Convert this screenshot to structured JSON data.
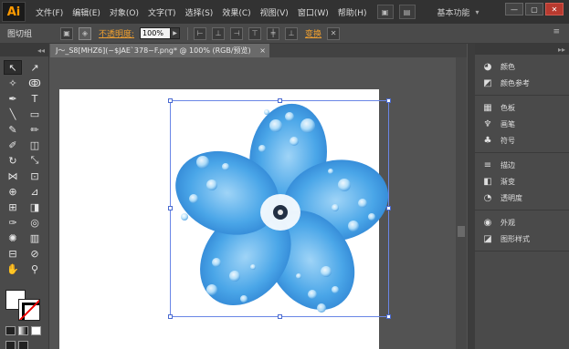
{
  "app": {
    "logo": "Ai"
  },
  "menu": [
    "文件(F)",
    "编辑(E)",
    "对象(O)",
    "文字(T)",
    "选择(S)",
    "效果(C)",
    "视图(V)",
    "窗口(W)",
    "帮助(H)"
  ],
  "menubar": {
    "workspace": "基本功能",
    "workspace_caret": "▾",
    "window_buttons": {
      "minimize": "—",
      "maximize": "▢",
      "close": "✕"
    }
  },
  "control": {
    "selection_label": "图切组",
    "opacity_label": "不透明度:",
    "opacity_value": "100%",
    "transform_label": "变换"
  },
  "document": {
    "tab_title": "J～_S8[MHZ6](~$JAE`378~F.png* @ 100% (RGB/预览)",
    "close": "×"
  },
  "panels": {
    "group1": [
      {
        "icon": "palette-icon",
        "glyph": "◕",
        "label": "颜色"
      },
      {
        "icon": "color-guide-icon",
        "glyph": "◩",
        "label": "颜色参考"
      }
    ],
    "group2": [
      {
        "icon": "swatches-icon",
        "glyph": "▦",
        "label": "色板"
      },
      {
        "icon": "brushes-icon",
        "glyph": "♆",
        "label": "画笔"
      },
      {
        "icon": "symbols-icon",
        "glyph": "♣",
        "label": "符号"
      }
    ],
    "group3": [
      {
        "icon": "stroke-icon",
        "glyph": "≡",
        "label": "描边"
      },
      {
        "icon": "gradient-icon",
        "glyph": "◧",
        "label": "渐变"
      },
      {
        "icon": "transparency-icon",
        "glyph": "◔",
        "label": "透明度"
      }
    ],
    "group4": [
      {
        "icon": "appearance-icon",
        "glyph": "◉",
        "label": "外观"
      },
      {
        "icon": "graphic-styles-icon",
        "glyph": "◪",
        "label": "图形样式"
      }
    ]
  },
  "tools": [
    {
      "name": "selection-tool-icon",
      "glyph": "↖"
    },
    {
      "name": "direct-selection-tool-icon",
      "glyph": "↗"
    },
    {
      "name": "magic-wand-tool-icon",
      "glyph": "✧"
    },
    {
      "name": "lasso-tool-icon",
      "glyph": "ↂ"
    },
    {
      "name": "pen-tool-icon",
      "glyph": "✒"
    },
    {
      "name": "type-tool-icon",
      "glyph": "T"
    },
    {
      "name": "line-tool-icon",
      "glyph": "╲"
    },
    {
      "name": "rectangle-tool-icon",
      "glyph": "▭"
    },
    {
      "name": "paintbrush-tool-icon",
      "glyph": "✎"
    },
    {
      "name": "pencil-tool-icon",
      "glyph": "✏"
    },
    {
      "name": "blob-brush-tool-icon",
      "glyph": "✐"
    },
    {
      "name": "eraser-tool-icon",
      "glyph": "◫"
    },
    {
      "name": "rotate-tool-icon",
      "glyph": "↻"
    },
    {
      "name": "scale-tool-icon",
      "glyph": "⤡"
    },
    {
      "name": "width-tool-icon",
      "glyph": "⋈"
    },
    {
      "name": "free-transform-tool-icon",
      "glyph": "⊡"
    },
    {
      "name": "shape-builder-tool-icon",
      "glyph": "⊕"
    },
    {
      "name": "perspective-grid-tool-icon",
      "glyph": "⊿"
    },
    {
      "name": "mesh-tool-icon",
      "glyph": "⊞"
    },
    {
      "name": "gradient-tool-icon",
      "glyph": "◨"
    },
    {
      "name": "eyedropper-tool-icon",
      "glyph": "✑"
    },
    {
      "name": "blend-tool-icon",
      "glyph": "◎"
    },
    {
      "name": "symbol-sprayer-tool-icon",
      "glyph": "✺"
    },
    {
      "name": "column-graph-tool-icon",
      "glyph": "▥"
    },
    {
      "name": "artboard-tool-icon",
      "glyph": "⊟"
    },
    {
      "name": "slice-tool-icon",
      "glyph": "⊘"
    },
    {
      "name": "hand-tool-icon",
      "glyph": "✋"
    },
    {
      "name": "zoom-tool-icon",
      "glyph": "⚲"
    }
  ]
}
